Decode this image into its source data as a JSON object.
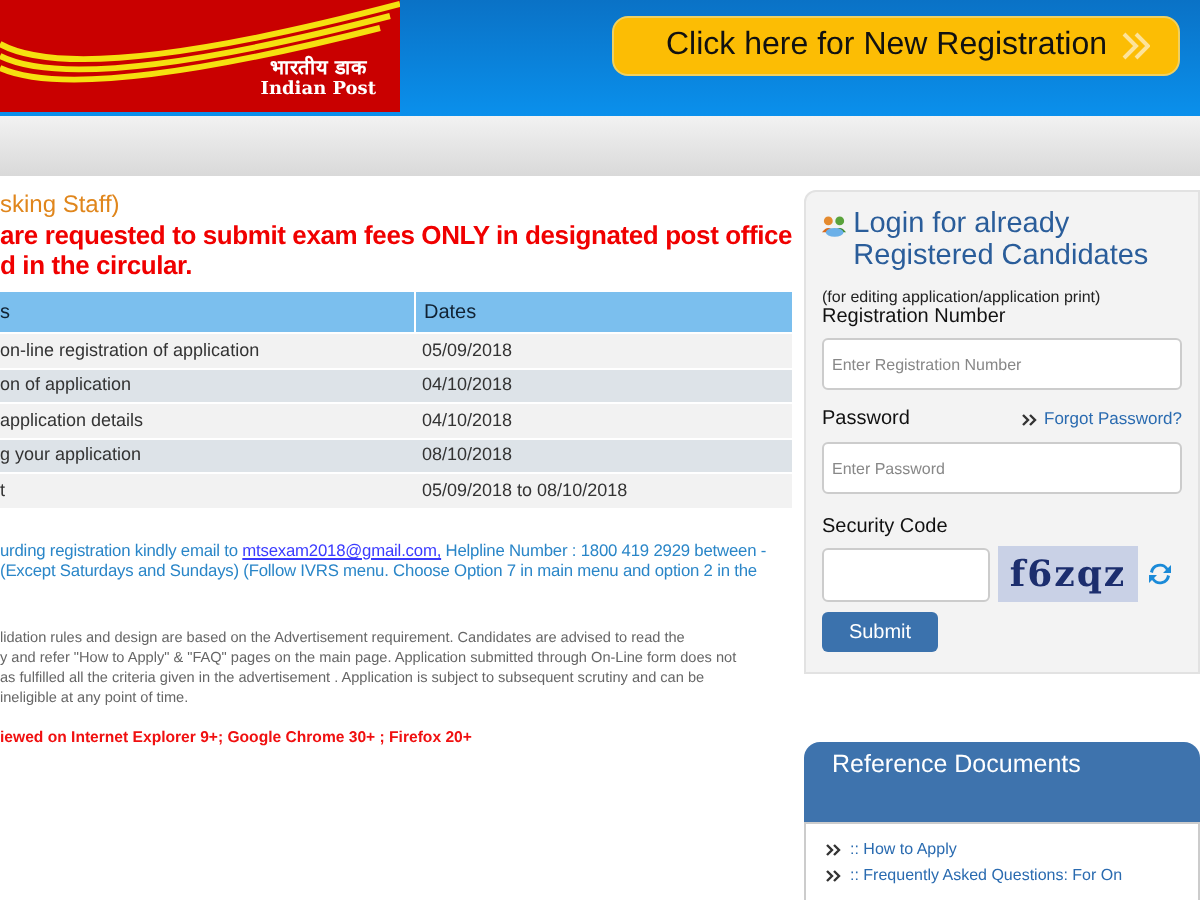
{
  "header": {
    "logo": {
      "hindi": "भारतीय डाक",
      "english": "Indian Post"
    },
    "registration_button": "Click here for New Registration"
  },
  "main": {
    "subtitle": "sking Staff)",
    "notice_lines": [
      "are requested to submit exam fees ONLY in designated post office",
      "d in the circular."
    ],
    "table": {
      "columns": [
        "s",
        "Dates"
      ],
      "rows": [
        [
          "on-line registration of application",
          "05/09/2018"
        ],
        [
          "on of application",
          "04/10/2018"
        ],
        [
          "application details",
          "04/10/2018"
        ],
        [
          "g your application",
          "08/10/2018"
        ],
        [
          "t",
          "05/09/2018 to 08/10/2018"
        ]
      ]
    },
    "help_lines": [
      {
        "before": "urding registration kindly email to ",
        "link": "mtsexam2018@gmail.com,",
        "after": " Helpline Number : 1800 419 2929 between -"
      },
      {
        "before": "(Except Saturdays and Sundays) (Follow IVRS menu. Choose Option 7 in main menu and option 2 in the"
      }
    ],
    "disclaimer_lines": [
      "lidation rules and design are based on the Advertisement requirement. Candidates are advised to read the",
      "y and refer \"How to Apply\" & \"FAQ\" pages on the main page. Application submitted through On-Line form does not",
      "as fulfilled all the criteria given in the advertisement . Application is subject to subsequent scrutiny and can be",
      "ineligible at any point of time."
    ],
    "browser_note": "iewed on Internet Explorer 9+; Google Chrome 30+ ; Firefox 20+"
  },
  "login": {
    "title": "Login for already Registered Candidates",
    "subtitle": "(for editing application/application print)",
    "registration_label": "Registration Number",
    "registration_placeholder": "Enter Registration Number",
    "password_label": "Password",
    "forgot_link": "Forgot Password?",
    "password_placeholder": "Enter Password",
    "security_label": "Security Code",
    "captcha_text": "f6zqz",
    "submit": "Submit"
  },
  "reference": {
    "title": "Reference Documents",
    "items": [
      ":: How to Apply",
      ":: Frequently Asked Questions: For On"
    ]
  }
}
